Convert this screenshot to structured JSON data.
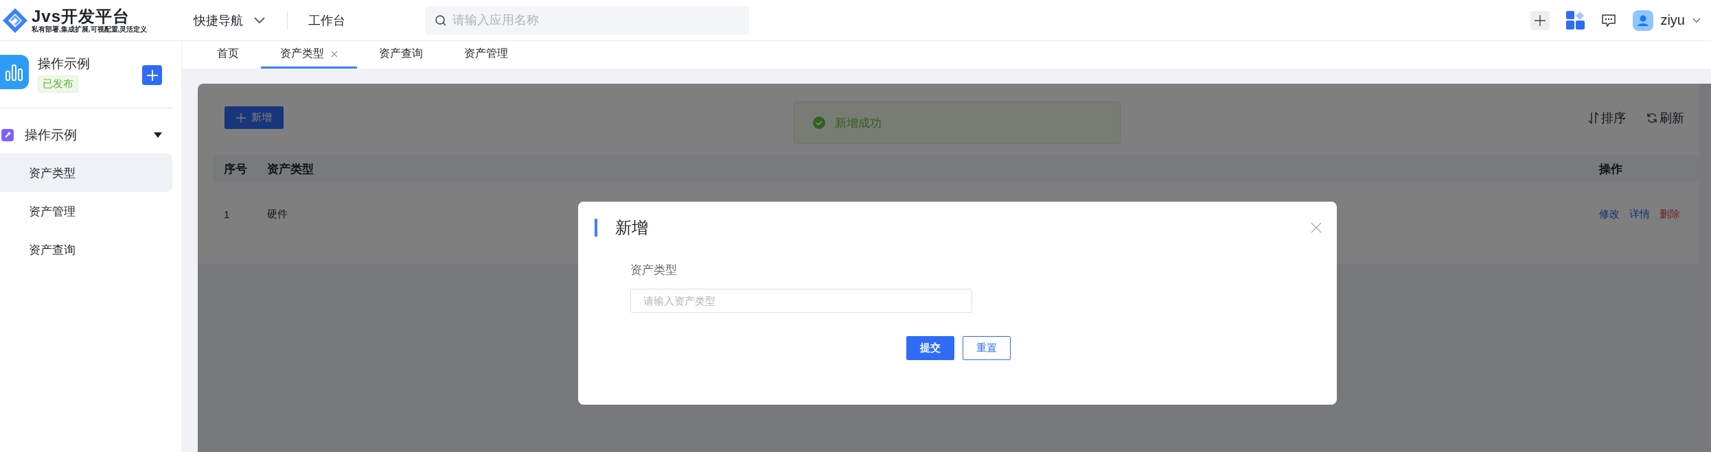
{
  "header": {
    "logo": {
      "title": "Jvs开发平台",
      "subtitle": "私有部署,集成扩展,可视配置,灵活定义"
    },
    "nav": [
      {
        "label": "快捷导航",
        "kind": "dropdown"
      },
      {
        "label": "工作台",
        "kind": "link"
      }
    ],
    "search": {
      "placeholder": "请输入应用名称"
    },
    "user": {
      "name": "ziyu"
    }
  },
  "app": {
    "name": "操作示例",
    "status": "已发布"
  },
  "sidebar": {
    "groups": [
      {
        "label": "操作示例",
        "expanded": true,
        "children": [
          {
            "label": "资产类型",
            "selected": true
          },
          {
            "label": "资产管理",
            "selected": false
          },
          {
            "label": "资产查询",
            "selected": false
          }
        ]
      }
    ]
  },
  "tabs": [
    {
      "label": "首页",
      "selected": false,
      "closable": false
    },
    {
      "label": "资产类型",
      "selected": true,
      "closable": true
    },
    {
      "label": "资产查询",
      "selected": false,
      "closable": false
    },
    {
      "label": "资产管理",
      "selected": false,
      "closable": false
    }
  ],
  "toolbar": {
    "add_button": "新增",
    "actions": [
      {
        "label": "排序",
        "kind": "sort"
      },
      {
        "label": "刷新",
        "kind": "refresh"
      }
    ]
  },
  "toast": {
    "message": "新增成功",
    "kind": "success"
  },
  "table": {
    "columns": [
      "序号",
      "资产类型",
      "操作"
    ],
    "rows": [
      {
        "cells": [
          "1",
          "硬件"
        ],
        "actions": [
          {
            "label": "修改",
            "kind": "normal"
          },
          {
            "label": "详情",
            "kind": "normal"
          },
          {
            "label": "删除",
            "kind": "danger"
          }
        ]
      }
    ]
  },
  "dialog": {
    "title": "新增",
    "fields": [
      {
        "label": "资产类型",
        "placeholder": "请输入资产类型"
      }
    ],
    "buttons": [
      {
        "label": "提交",
        "kind": "primary"
      },
      {
        "label": "重置",
        "kind": "default"
      }
    ]
  }
}
